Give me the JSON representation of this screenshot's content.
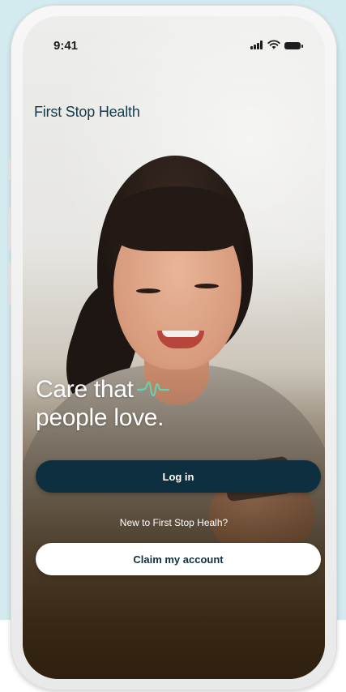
{
  "status_bar": {
    "time": "9:41",
    "signal_icon": "cellular-signal-icon",
    "wifi_icon": "wifi-icon",
    "battery_icon": "battery-icon"
  },
  "brand": {
    "name": "First Stop Health"
  },
  "hero": {
    "headline_line1": "Care that",
    "headline_line2": "people love.",
    "accent_icon": "heartbeat-pulse-icon",
    "accent_color": "#5fd3b4"
  },
  "actions": {
    "login_label": "Log in",
    "new_user_prompt": "New to First Stop Healh?",
    "claim_label": "Claim my account"
  },
  "colors": {
    "primary_dark": "#0e2f3f",
    "brand_text": "#173a4a",
    "backdrop": "#d3ebee"
  }
}
